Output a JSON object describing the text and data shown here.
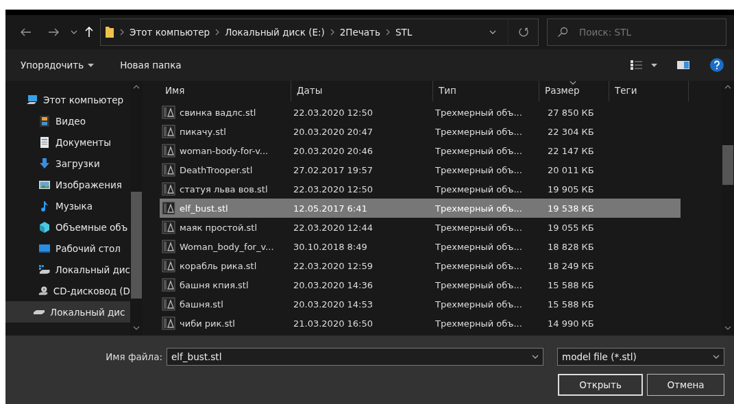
{
  "address_bar": {
    "segments": [
      "Этот компьютер",
      "Локальный диск (E:)",
      "2Печать",
      "STL"
    ]
  },
  "search": {
    "placeholder": "Поиск: STL"
  },
  "toolbar": {
    "buttons": [
      "Упорядочить",
      "Новая папка"
    ]
  },
  "sidebar": {
    "items": [
      {
        "label": "Этот компьютер",
        "kind": "computer",
        "selected": false
      },
      {
        "label": "Видео",
        "kind": "video",
        "selected": false
      },
      {
        "label": "Документы",
        "kind": "documents",
        "selected": false
      },
      {
        "label": "Загрузки",
        "kind": "downloads",
        "selected": false
      },
      {
        "label": "Изображения",
        "kind": "images",
        "selected": false
      },
      {
        "label": "Музыка",
        "kind": "music",
        "selected": false
      },
      {
        "label": "Объемные объ",
        "kind": "objects",
        "selected": false
      },
      {
        "label": "Рабочий стол",
        "kind": "desktop",
        "selected": false
      },
      {
        "label": "Локальный дис",
        "kind": "windisk",
        "selected": false
      },
      {
        "label": "CD-дисковод (D",
        "kind": "cd",
        "selected": false
      },
      {
        "label": "Локальный дис",
        "kind": "disk",
        "selected": true
      }
    ]
  },
  "table": {
    "columns": [
      "Имя",
      "Даты",
      "Тип",
      "Размер",
      "Теги"
    ],
    "rows": [
      {
        "name": "свинка вадлс.stl",
        "date": "22.03.2020 12:50",
        "type": "Трехмерный объ...",
        "size": "27 850 КБ",
        "selected": false
      },
      {
        "name": "пикачу.stl",
        "date": "20.03.2020 20:47",
        "type": "Трехмерный объ...",
        "size": "22 304 КБ",
        "selected": false
      },
      {
        "name": "woman-body-for-v...",
        "date": "20.03.2020 20:46",
        "type": "Трехмерный объ...",
        "size": "22 147 КБ",
        "selected": false
      },
      {
        "name": "DeathTrooper.stl",
        "date": "27.02.2017 19:57",
        "type": "Трехмерный объ...",
        "size": "20 011 КБ",
        "selected": false
      },
      {
        "name": "статуя льва вов.stl",
        "date": "22.03.2020 12:50",
        "type": "Трехмерный объ...",
        "size": "19 905 КБ",
        "selected": false
      },
      {
        "name": "elf_bust.stl",
        "date": "12.05.2017 6:41",
        "type": "Трехмерный объ...",
        "size": "19 538 КБ",
        "selected": true
      },
      {
        "name": "маяк простой.stl",
        "date": "22.03.2020 12:44",
        "type": "Трехмерный объ...",
        "size": "19 055 КБ",
        "selected": false
      },
      {
        "name": "Woman_body_for_v...",
        "date": "30.10.2018 8:49",
        "type": "Трехмерный объ...",
        "size": "18 828 КБ",
        "selected": false
      },
      {
        "name": "корабль рика.stl",
        "date": "22.03.2020 12:59",
        "type": "Трехмерный объ...",
        "size": "18 249 КБ",
        "selected": false
      },
      {
        "name": "башня кпия.stl",
        "date": "20.03.2020 14:36",
        "type": "Трехмерный объ...",
        "size": "15 588 КБ",
        "selected": false
      },
      {
        "name": "башня.stl",
        "date": "20.03.2020 14:53",
        "type": "Трехмерный объ...",
        "size": "15 588 КБ",
        "selected": false
      },
      {
        "name": "чиби рик.stl",
        "date": "21.03.2020 16:50",
        "type": "Трехмерный объ...",
        "size": "14 990 КБ",
        "selected": false
      }
    ]
  },
  "footer": {
    "file_name_label": "Имя файла:",
    "file_name": "elf_bust.stl",
    "filter": "model file (*.stl)",
    "buttons": [
      "Открыть",
      "Отмена"
    ]
  }
}
